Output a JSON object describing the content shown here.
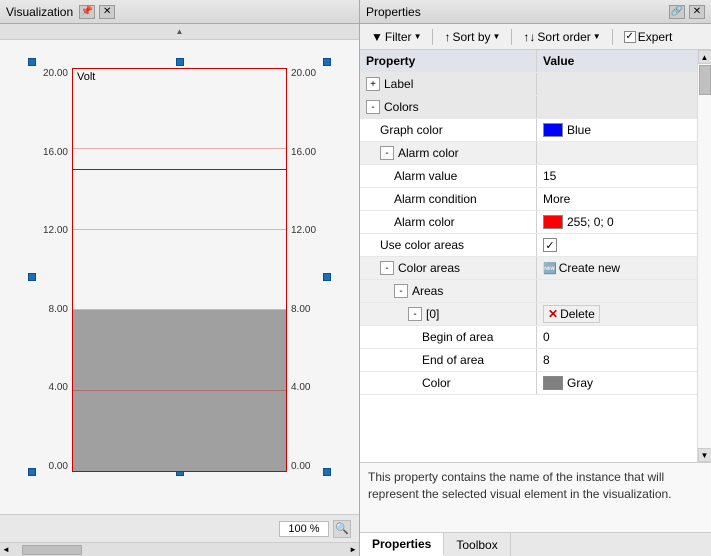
{
  "viz": {
    "title": "Visualization",
    "pin_label": "📌",
    "close_label": "✕",
    "y_labels_left": [
      "0.00",
      "4.00",
      "8.00",
      "12.00",
      "16.00",
      "20.00"
    ],
    "y_labels_right": [
      "0.00",
      "4.00",
      "8.00",
      "12.00",
      "16.00",
      "20.00"
    ],
    "chart_label": "Volt",
    "zoom": "100 %",
    "scroll_arrow_up": "▲",
    "scroll_arrow_left": "◄",
    "scroll_arrow_right": "►"
  },
  "props": {
    "title": "Properties",
    "pin_label": "🔗",
    "close_label": "✕",
    "toolbar": {
      "filter_label": "Filter",
      "sort_by_label": "Sort by",
      "sort_order_label": "Sort order",
      "expert_label": "Expert",
      "filter_icon": "▼",
      "sort_icon_asc": "↑↓",
      "sort_icon_desc": "↑↓"
    },
    "columns": {
      "property": "Property",
      "value": "Value"
    },
    "rows": [
      {
        "id": "label-header",
        "type": "section",
        "indent": 0,
        "expand": "+",
        "name": "Label",
        "value": ""
      },
      {
        "id": "colors-header",
        "type": "section",
        "indent": 0,
        "expand": "-",
        "name": "Colors",
        "value": ""
      },
      {
        "id": "graph-color",
        "type": "data",
        "indent": 1,
        "name": "Graph color",
        "value": "Blue",
        "color": "#0000ff"
      },
      {
        "id": "alarm-color-header",
        "type": "subsection",
        "indent": 1,
        "expand": "-",
        "name": "Alarm color",
        "value": ""
      },
      {
        "id": "alarm-value",
        "type": "data",
        "indent": 2,
        "name": "Alarm value",
        "value": "15"
      },
      {
        "id": "alarm-condition",
        "type": "data",
        "indent": 2,
        "name": "Alarm condition",
        "value": "More"
      },
      {
        "id": "alarm-color",
        "type": "data",
        "indent": 2,
        "name": "Alarm color",
        "value": "255; 0; 0",
        "color": "#ff0000"
      },
      {
        "id": "use-color-areas",
        "type": "checkbox",
        "indent": 1,
        "name": "Use color areas",
        "checked": true
      },
      {
        "id": "color-areas-header",
        "type": "subsection",
        "indent": 1,
        "expand": "-",
        "name": "Color areas",
        "value": "",
        "create_new": true
      },
      {
        "id": "areas-header",
        "type": "subsection",
        "indent": 2,
        "expand": "-",
        "name": "Areas",
        "value": ""
      },
      {
        "id": "areas-0",
        "type": "subsection",
        "indent": 3,
        "expand": "-",
        "name": "[0]",
        "value": "",
        "delete": true
      },
      {
        "id": "begin-of-area",
        "type": "data",
        "indent": 4,
        "name": "Begin of area",
        "value": "0"
      },
      {
        "id": "end-of-area",
        "type": "data",
        "indent": 4,
        "name": "End of area",
        "value": "8"
      },
      {
        "id": "color-row",
        "type": "data",
        "indent": 4,
        "name": "Color",
        "value": "Gray",
        "color": "#808080"
      }
    ],
    "description": "This property contains the name of the instance that will represent the selected visual element in the visualization.",
    "tabs": [
      {
        "id": "properties-tab",
        "label": "Properties",
        "active": true
      },
      {
        "id": "toolbox-tab",
        "label": "Toolbox",
        "active": false
      }
    ]
  }
}
